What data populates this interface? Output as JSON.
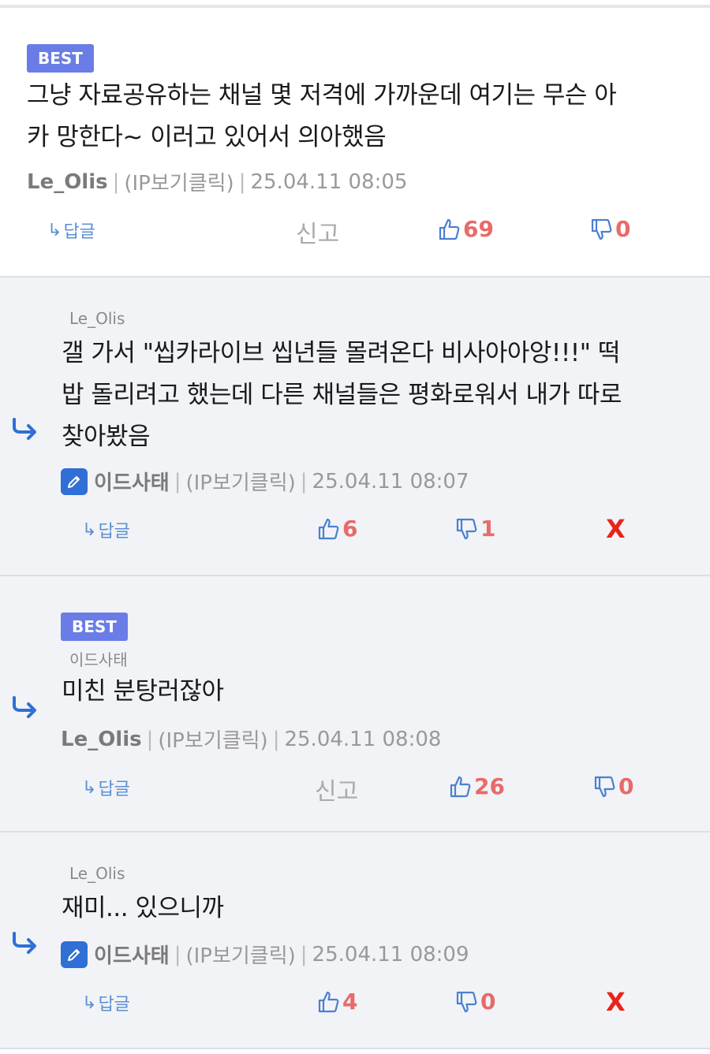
{
  "comments": [
    {
      "badge": "BEST",
      "text_lines": [
        "그냥 자료공유하는 채널 몇 저격에 가까운데 여기는 무슨 아",
        "카 망한다~ 이러고 있어서 의아했음"
      ],
      "author": "Le_Olis",
      "ip": "(IP보기클릭)",
      "date": "25.04.11 08:05",
      "reply_label": "답글",
      "report_label": "신고",
      "likes": "69",
      "dislikes": "0"
    },
    {
      "parent": "Le_Olis",
      "text_lines": [
        "갤 가서 \"씹카라이브 씹년들 몰려온다 비사아아앙!!!\" 떡",
        "밥 돌리려고 했는데 다른 채널들은 평화로워서 내가 따로",
        "찾아봤음"
      ],
      "author": "이드사태",
      "ip": "(IP보기클릭)",
      "date": "25.04.11 08:07",
      "reply_label": "답글",
      "likes": "6",
      "dislikes": "1",
      "delete_label": "X"
    },
    {
      "badge": "BEST",
      "parent": "이드사태",
      "text_lines": [
        "미친 분탕러잖아"
      ],
      "author": "Le_Olis",
      "ip": "(IP보기클릭)",
      "date": "25.04.11 08:08",
      "reply_label": "답글",
      "report_label": "신고",
      "likes": "26",
      "dislikes": "0"
    },
    {
      "parent": "Le_Olis",
      "text_lines": [
        "재미... 있으니까"
      ],
      "author": "이드사태",
      "ip": "(IP보기클릭)",
      "date": "25.04.11 08:09",
      "reply_label": "답글",
      "likes": "4",
      "dislikes": "0",
      "delete_label": "X"
    }
  ],
  "icons": {
    "reply": "reply-arrow-icon",
    "like": "thumbs-up-icon",
    "dislike": "thumbs-down-icon",
    "child": "child-reply-arrow-icon",
    "author_badge": "pencil-icon"
  },
  "colors": {
    "best_badge": "#6a7de6",
    "vote_count": "#e86a6a",
    "delete": "#e8241b",
    "icon_blue": "#2f6fd6"
  }
}
